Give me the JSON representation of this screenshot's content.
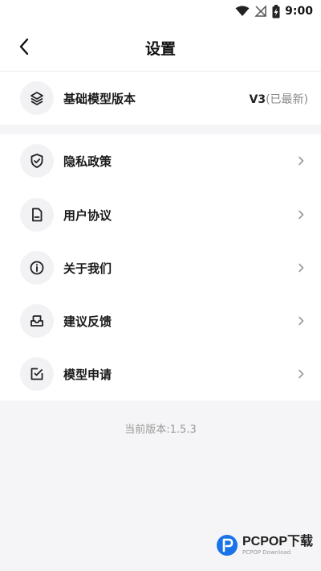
{
  "status_bar": {
    "time": "9:00"
  },
  "header": {
    "title": "设置"
  },
  "model_version": {
    "label": "基础模型版本",
    "value": "V3",
    "note": "(已最新)"
  },
  "menu": {
    "items": [
      {
        "label": "隐私政策",
        "icon": "shield-check-icon"
      },
      {
        "label": "用户协议",
        "icon": "document-icon"
      },
      {
        "label": "关于我们",
        "icon": "info-icon"
      },
      {
        "label": "建议反馈",
        "icon": "inbox-icon"
      },
      {
        "label": "模型申请",
        "icon": "edit-icon"
      }
    ]
  },
  "footer": {
    "version": "当前版本:1.5.3"
  },
  "watermark": {
    "brand": "PCPOP下载",
    "sub": "PCPOP Download"
  }
}
